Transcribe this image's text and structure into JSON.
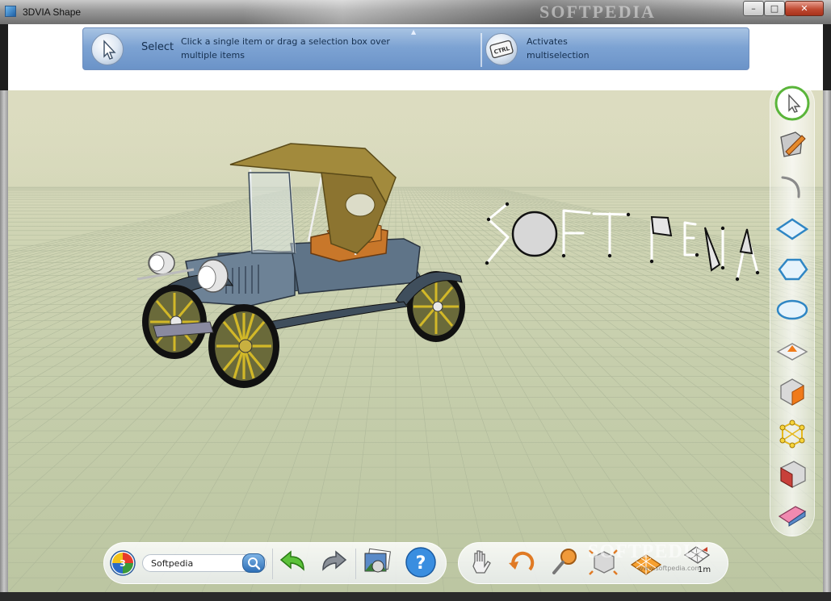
{
  "window": {
    "title": "3DVIA Shape",
    "watermark": "SOFTPEDIA",
    "controls": {
      "minimize": "–",
      "maximize": "□",
      "close": "✕"
    }
  },
  "hint_bar": {
    "tool_icon": "select-arrow-icon",
    "tool_label": "Select",
    "tool_description": "Click a single item or drag a selection box over multiple items",
    "modifier_icon": "ctrl-key-icon",
    "modifier_key": "CTRL",
    "modifier_description": "Activates multiselection"
  },
  "scene": {
    "text_object": "SOFTPEDIA",
    "object": "vintage-car-model"
  },
  "right_toolbar": {
    "tools": [
      {
        "name": "select-tool-icon"
      },
      {
        "name": "draw-tool-icon"
      },
      {
        "name": "arc-tool-icon"
      },
      {
        "name": "rectangle-tool-icon"
      },
      {
        "name": "polygon-tool-icon"
      },
      {
        "name": "ellipse-tool-icon"
      },
      {
        "name": "push-pull-tool-icon"
      },
      {
        "name": "move-tool-icon"
      },
      {
        "name": "rotate-tool-icon"
      },
      {
        "name": "paint-tool-icon"
      },
      {
        "name": "eraser-tool-icon"
      }
    ]
  },
  "bottom_toolbar": {
    "logo_icon": "3dvia-logo-icon",
    "search": {
      "value": "Softpedia",
      "icon": "search-icon"
    },
    "left_tools": [
      "undo-icon",
      "redo-icon",
      "screenshot-icon",
      "help-icon"
    ],
    "right_tools": [
      "pan-hand-icon",
      "orbit-icon",
      "zoom-icon",
      "view-cube-icon",
      "grid-toggle-icon",
      "scale-icon"
    ],
    "scale_label": "1m",
    "watermark": "SOFTPEDIA",
    "watermark_sub": "www.softpedia.com"
  },
  "colors": {
    "hint_bar": "#7da3d3",
    "ground": "#c6ceac",
    "car_body": "#5b6f82",
    "car_top": "#a08a3a",
    "wheel_spokes": "#b8a020",
    "seat": "#c87a2a"
  }
}
